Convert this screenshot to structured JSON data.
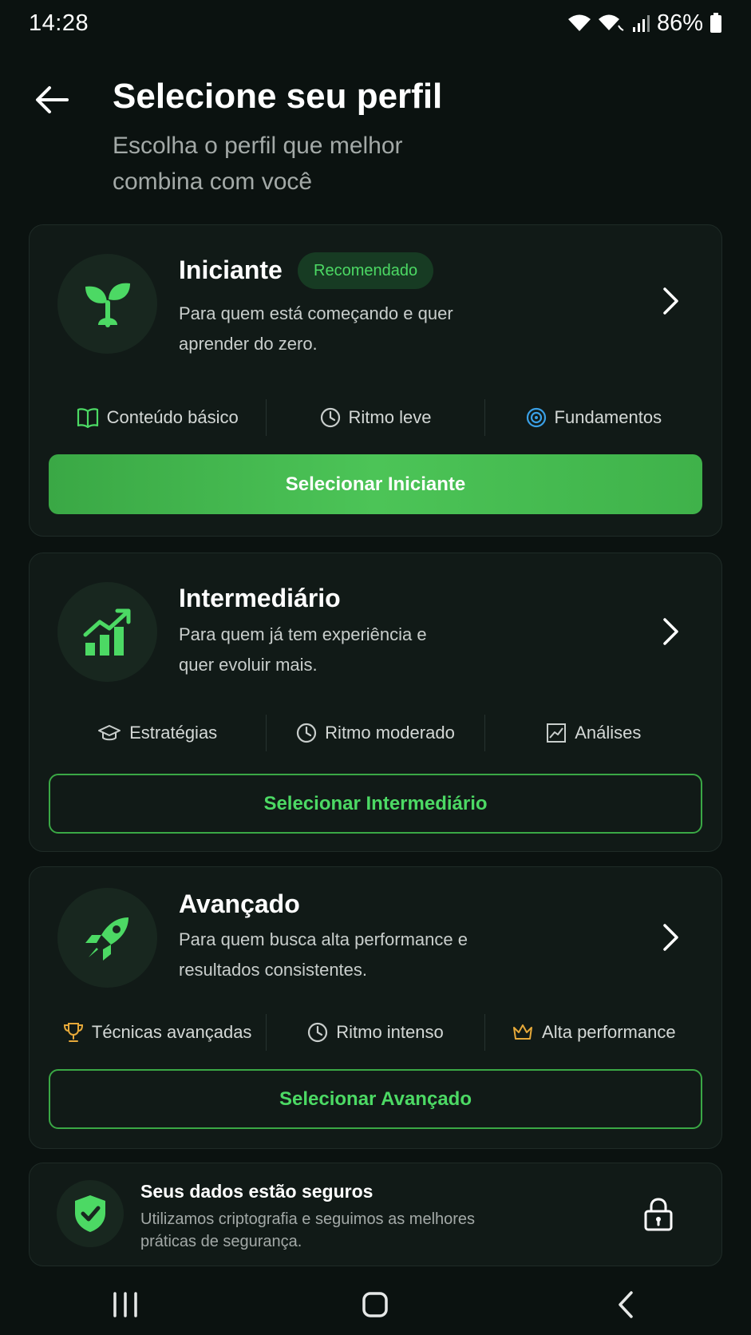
{
  "status": {
    "time": "14:28",
    "battery": "86%"
  },
  "header": {
    "title": "Selecione seu perfil",
    "subtitle": "Escolha o perfil que melhor combina com você"
  },
  "profiles": [
    {
      "title": "Iniciante",
      "badge": "Recomendado",
      "description": "Para quem está começando e quer aprender do zero.",
      "icon": "sprout-icon",
      "features": [
        {
          "icon": "book-icon",
          "label": "Conteúdo básico"
        },
        {
          "icon": "clock-icon",
          "label": "Ritmo leve"
        },
        {
          "icon": "target-icon",
          "label": "Fundamentos"
        }
      ],
      "button_label": "Selecionar Iniciante"
    },
    {
      "title": "Intermediário",
      "description": "Para quem já tem experiência e quer evoluir mais.",
      "icon": "growth-chart-icon",
      "features": [
        {
          "icon": "graduation-cap-icon",
          "label": "Estratégias"
        },
        {
          "icon": "clock-icon",
          "label": "Ritmo moderado"
        },
        {
          "icon": "line-chart-icon",
          "label": "Análises"
        }
      ],
      "button_label": "Selecionar Intermediário"
    },
    {
      "title": "Avançado",
      "description": "Para quem busca alta performance e resultados consistentes.",
      "icon": "rocket-icon",
      "features": [
        {
          "icon": "trophy-icon",
          "label": "Técnicas avançadas"
        },
        {
          "icon": "clock-icon",
          "label": "Ritmo intenso"
        },
        {
          "icon": "crown-icon",
          "label": "Alta performance"
        }
      ],
      "button_label": "Selecionar Avançado"
    }
  ],
  "security": {
    "title": "Seus dados estão seguros",
    "description": "Utilizamos criptografia e seguimos as melhores práticas de segurança."
  },
  "colors": {
    "background": "#0b1210",
    "card": "#111a17",
    "accent": "#4cd964",
    "accent_dark": "#3aa845",
    "gold": "#e6a93a",
    "blue": "#3aa0e6"
  }
}
